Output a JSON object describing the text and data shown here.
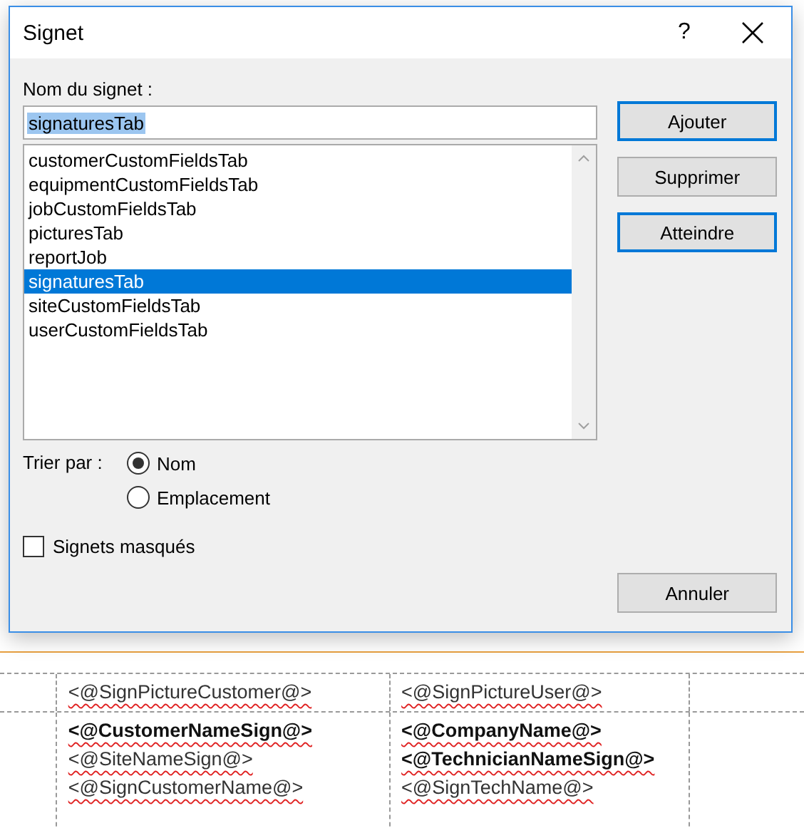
{
  "window": {
    "title": "Signet",
    "help_button": "?"
  },
  "name_label": "Nom du signet :",
  "name_field": {
    "value": "signaturesTab"
  },
  "bookmarks": [
    {
      "label": "customerCustomFieldsTab",
      "selected": false
    },
    {
      "label": "equipmentCustomFieldsTab",
      "selected": false
    },
    {
      "label": "jobCustomFieldsTab",
      "selected": false
    },
    {
      "label": "picturesTab",
      "selected": false
    },
    {
      "label": "reportJob",
      "selected": false
    },
    {
      "label": "signaturesTab",
      "selected": true
    },
    {
      "label": "siteCustomFieldsTab",
      "selected": false
    },
    {
      "label": "userCustomFieldsTab",
      "selected": false
    }
  ],
  "sort_label": "Trier par :",
  "sort_options": [
    {
      "label": "Nom",
      "selected": true
    },
    {
      "label": "Emplacement",
      "selected": false
    }
  ],
  "hidden_bookmarks": {
    "label": "Signets masqués",
    "checked": false
  },
  "buttons": [
    {
      "label": "Ajouter",
      "default": true
    },
    {
      "label": "Supprimer",
      "default": false
    },
    {
      "label": "Atteindre",
      "default": true
    }
  ],
  "cancel_button": "Annuler",
  "document_table": [
    {
      "cells": [
        [
          {
            "text": "<@SignPictureCustomer@>",
            "bold": false
          }
        ],
        [
          {
            "text": "<@SignPictureUser@>",
            "bold": false
          }
        ]
      ]
    },
    {
      "cells": [
        [
          {
            "text": "<@CustomerNameSign@>",
            "bold": true
          },
          {
            "text": "<@SiteNameSign@>",
            "bold": false
          },
          {
            "text": "<@SignCustomerName@>",
            "bold": false
          }
        ],
        [
          {
            "text": "<@CompanyName@>",
            "bold": true
          },
          {
            "text": "<@TechnicianNameSign@>",
            "bold": true
          },
          {
            "text": "<@SignTechName@>",
            "bold": false
          }
        ]
      ]
    }
  ]
}
